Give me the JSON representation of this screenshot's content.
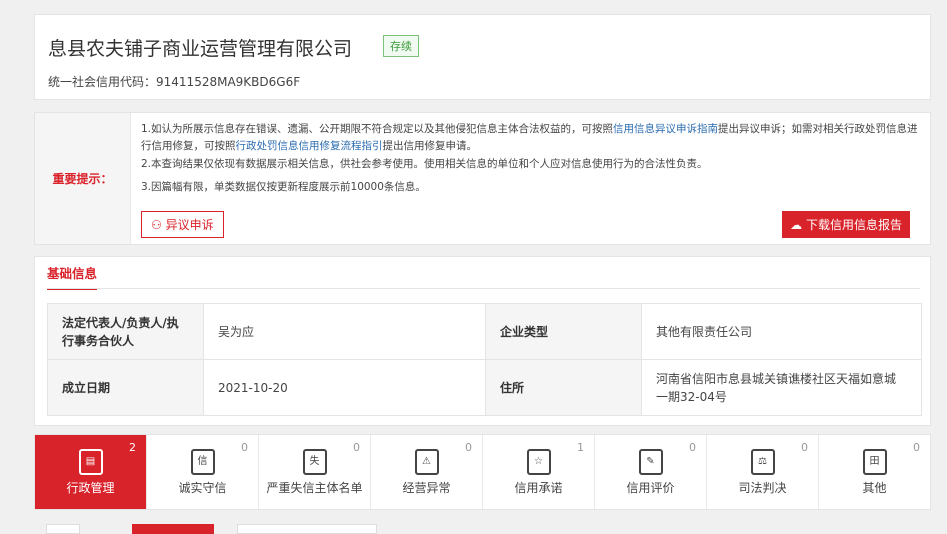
{
  "company": {
    "name": "息县农夫铺子商业运营管理有限公司",
    "status": "存续",
    "credit_code_label": "统一社会信用代码：",
    "credit_code": "91411528MA9KBD6G6F"
  },
  "notice": {
    "label": "重要提示：",
    "line1_a": "1.如认为所展示信息存在错误、遗漏、公开期限不符合规定以及其他侵犯信息主体合法权益的，可按照",
    "line1_link1": "信用信息异议申诉指南",
    "line1_b": "提出异议申诉；如需对相关行政处罚信息进行信用修复，可按照",
    "line1_link2": "行政处罚信息信用修复流程指引",
    "line1_c": "提出信用修复申请。",
    "line2": "2.本查询结果仅依现有数据展示相关信息，供社会参考使用。使用相关信息的单位和个人应对信息使用行为的合法性负责。",
    "line3": "3.因篇幅有限，单类数据仅按更新程度展示前10000条信息。",
    "appeal_btn": "异议申诉",
    "download_btn": "下载信用信息报告"
  },
  "basic": {
    "title": "基础信息",
    "rows": [
      {
        "k1": "法定代表人/负责人/执行事务合伙人",
        "v1": "吴为应",
        "k2": "企业类型",
        "v2": "其他有限责任公司"
      },
      {
        "k1": "成立日期",
        "v1": "2021-10-20",
        "k2": "住所",
        "v2": "河南省信阳市息县城关镇谯楼社区天福如意城一期32-04号"
      }
    ]
  },
  "tabs": [
    {
      "label": "行政管理",
      "count": "2",
      "icon": "▤"
    },
    {
      "label": "诚实守信",
      "count": "0",
      "icon": "信"
    },
    {
      "label": "严重失信主体名单",
      "count": "0",
      "icon": "失"
    },
    {
      "label": "经营异常",
      "count": "0",
      "icon": "⚠"
    },
    {
      "label": "信用承诺",
      "count": "1",
      "icon": "☆"
    },
    {
      "label": "信用评价",
      "count": "0",
      "icon": "✎"
    },
    {
      "label": "司法判决",
      "count": "0",
      "icon": "⚖"
    },
    {
      "label": "其他",
      "count": "0",
      "icon": "田"
    }
  ]
}
